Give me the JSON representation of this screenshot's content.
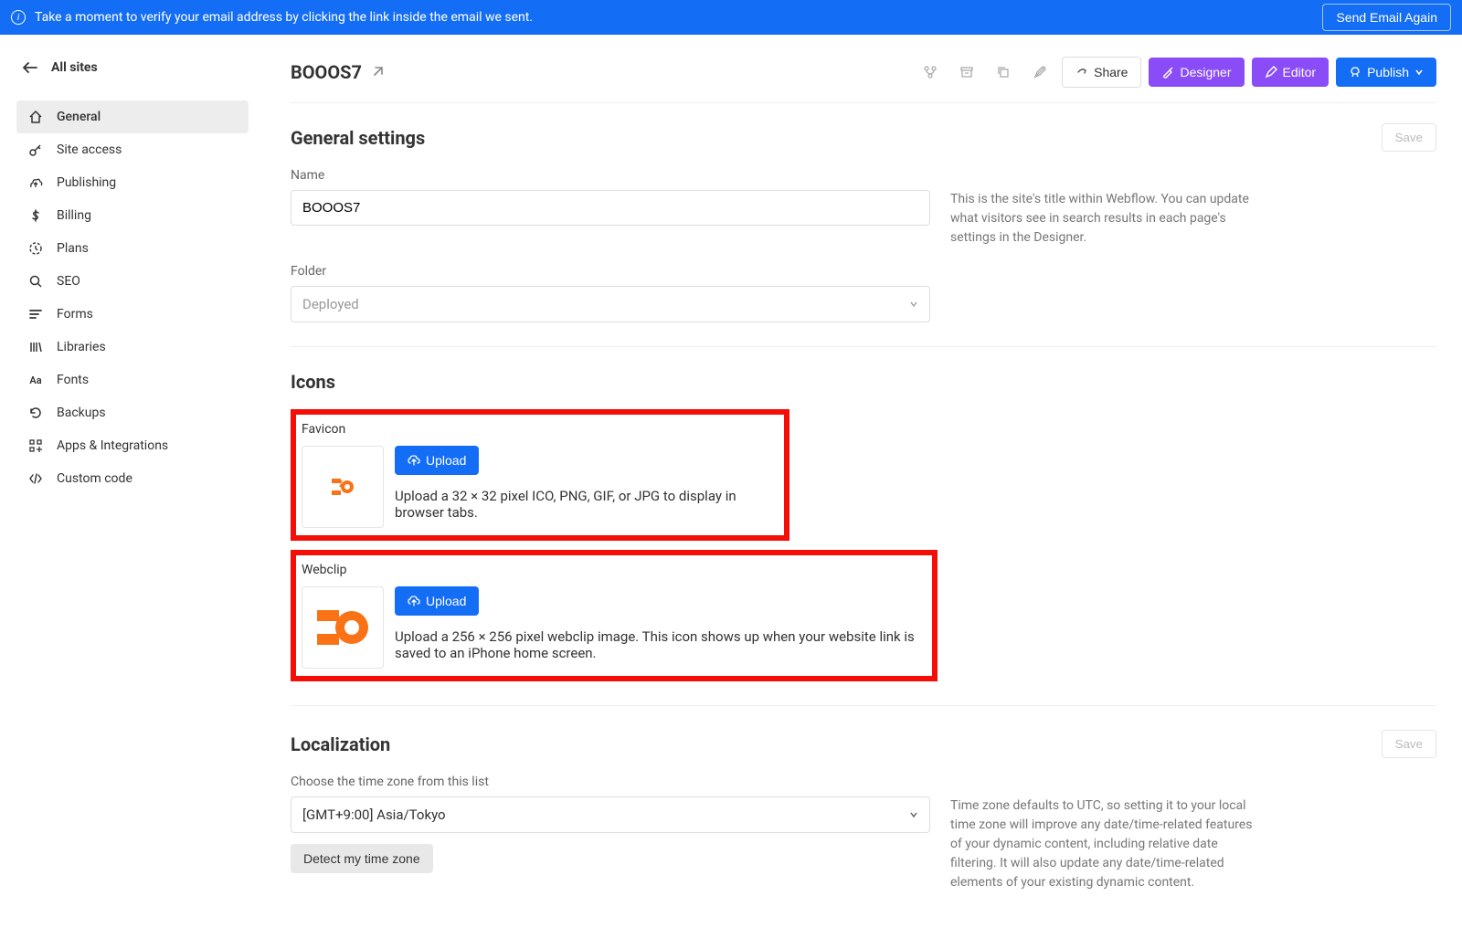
{
  "banner": {
    "text": "Take a moment to verify your email address by clicking the link inside the email we sent.",
    "button": "Send Email Again"
  },
  "sidebar": {
    "back": "All sites",
    "items": [
      {
        "label": "General",
        "active": true
      },
      {
        "label": "Site access"
      },
      {
        "label": "Publishing"
      },
      {
        "label": "Billing"
      },
      {
        "label": "Plans"
      },
      {
        "label": "SEO"
      },
      {
        "label": "Forms"
      },
      {
        "label": "Libraries"
      },
      {
        "label": "Fonts"
      },
      {
        "label": "Backups"
      },
      {
        "label": "Apps & Integrations"
      },
      {
        "label": "Custom code"
      }
    ]
  },
  "header": {
    "title": "BOOOS7",
    "share": "Share",
    "designer": "Designer",
    "editor": "Editor",
    "publish": "Publish"
  },
  "general": {
    "title": "General settings",
    "save": "Save",
    "name_label": "Name",
    "name_value": "BOOOS7",
    "name_help": "This is the site's title within Webflow. You can update what visitors see in search results in each page's settings in the Designer.",
    "folder_label": "Folder",
    "folder_value": "Deployed"
  },
  "icons": {
    "title": "Icons",
    "favicon_label": "Favicon",
    "upload": "Upload",
    "favicon_desc": "Upload a 32 × 32 pixel ICO, PNG, GIF, or JPG to display in browser tabs.",
    "webclip_label": "Webclip",
    "webclip_desc": "Upload a 256 × 256 pixel webclip image. This icon shows up when your website link is saved to an iPhone home screen."
  },
  "localization": {
    "title": "Localization",
    "save": "Save",
    "tz_label": "Choose the time zone from this list",
    "tz_value": "[GMT+9:00] Asia/Tokyo",
    "detect": "Detect my time zone",
    "tz_help": "Time zone defaults to UTC, so setting it to your local time zone will improve any date/time-related features of your dynamic content, including relative date filtering. It will also update any date/time-related elements of your existing dynamic content."
  }
}
